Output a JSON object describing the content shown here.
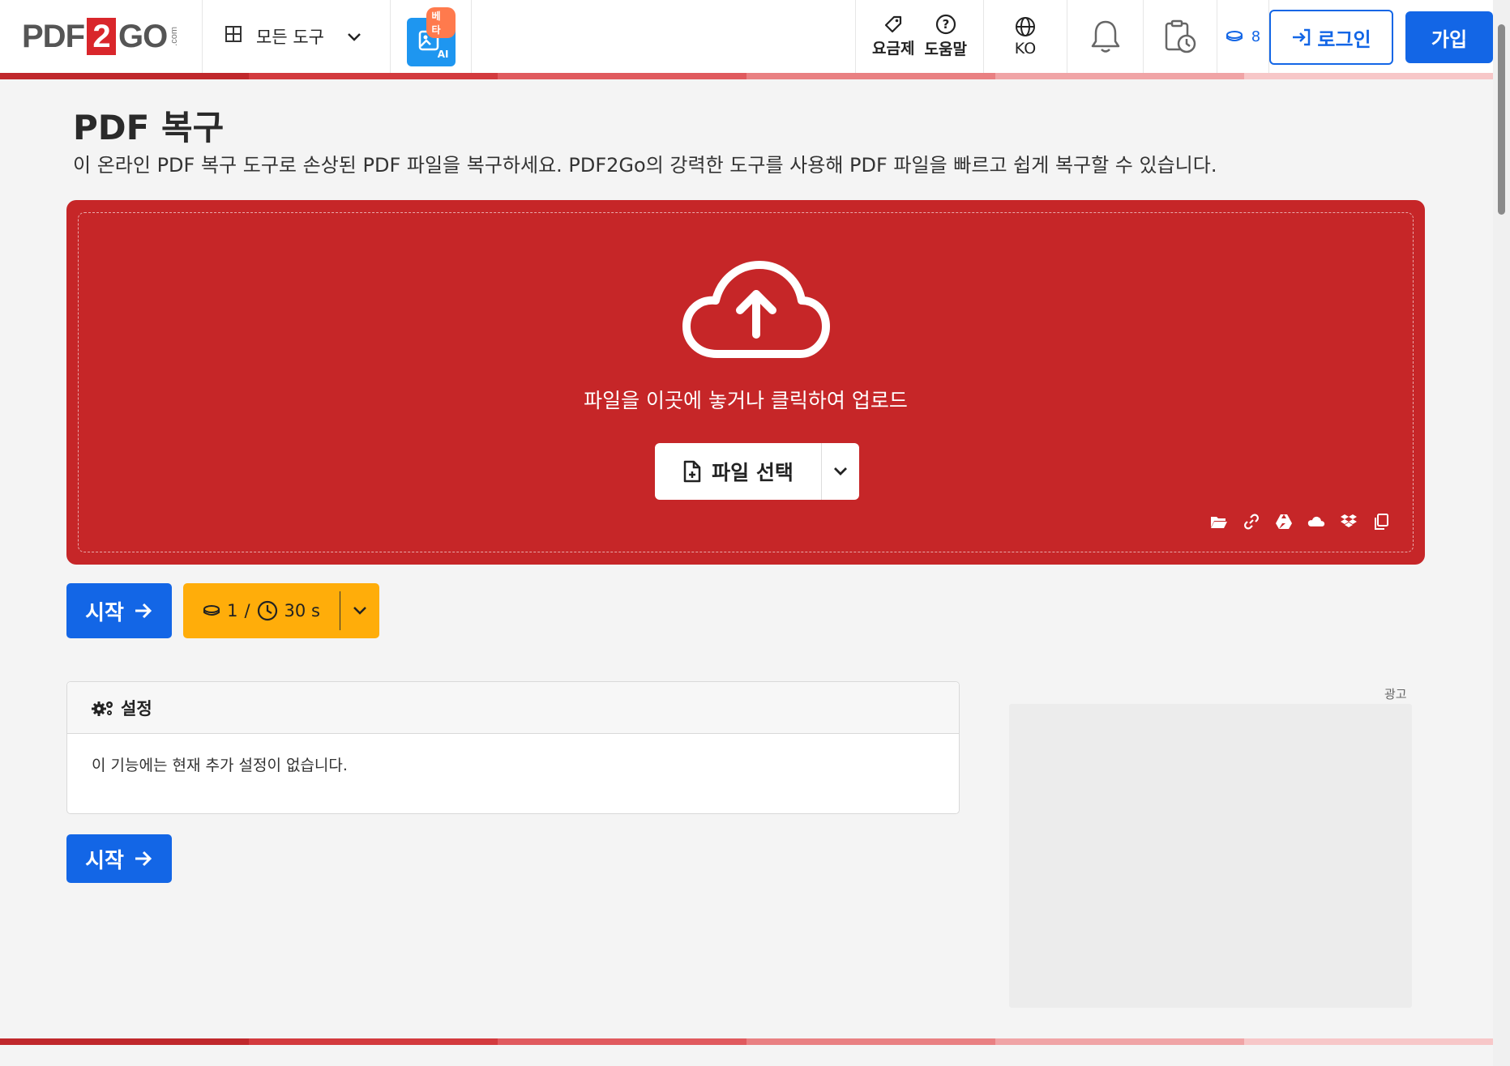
{
  "header": {
    "logo": {
      "pdf": "PDF",
      "two": "2",
      "go": "GO",
      "com": ".com"
    },
    "all_tools_label": "모든 도구",
    "ai_badge": "베타",
    "ai_icon_label": "AI",
    "pricing_label": "요금제",
    "help_label": "도움말",
    "language_label": "KO",
    "credits_count": "8",
    "login_label": "로그인",
    "signup_label": "가입"
  },
  "main": {
    "title": "PDF 복구",
    "description": "이 온라인 PDF 복구 도구로 손상된 PDF 파일을 복구하세요. PDF2Go의 강력한 도구를 사용해 PDF 파일을 빠르고 쉽게 복구할 수 있습니다.",
    "dropzone_text": "파일을 이곳에 놓거나 클릭하여 업로드",
    "choose_file_label": "파일 선택",
    "upload_sources": [
      "folder-icon",
      "link-icon",
      "google-drive-icon",
      "onedrive-icon",
      "dropbox-icon",
      "clipboard-icon"
    ],
    "start_label": "시작",
    "cost": {
      "credits": "1",
      "separator": "/",
      "time": "30 s"
    },
    "settings_title": "설정",
    "settings_text": "이 기능에는 현재 추가 설정이 없습니다.",
    "ad_label": "광고"
  },
  "colors": {
    "brand_red": "#c62628",
    "primary_blue": "#1366e6",
    "cost_yellow": "#ffad0a"
  }
}
